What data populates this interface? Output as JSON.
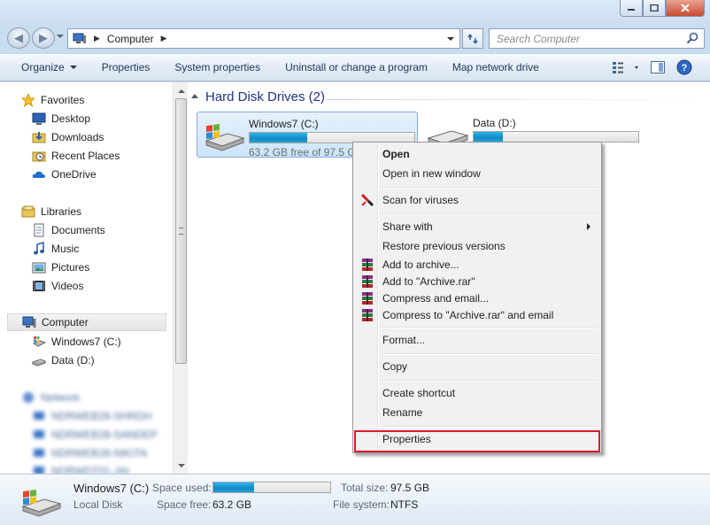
{
  "window": {
    "buttons": {
      "minimize": "minimize-icon",
      "maximize": "maximize-icon",
      "close": "close-icon"
    }
  },
  "address": {
    "location_icon": "computer-icon",
    "path": [
      "Computer"
    ],
    "search_placeholder": "Search Computer"
  },
  "toolbar": {
    "items": [
      {
        "label": "Organize",
        "dropdown": true
      },
      {
        "label": "Properties"
      },
      {
        "label": "System properties"
      },
      {
        "label": "Uninstall or change a program"
      },
      {
        "label": "Map network drive"
      }
    ],
    "right_icons": [
      "view-options-icon",
      "preview-pane-icon",
      "help-icon"
    ]
  },
  "nav": {
    "favorites": {
      "label": "Favorites",
      "items": [
        "Desktop",
        "Downloads",
        "Recent Places",
        "OneDrive"
      ]
    },
    "libraries": {
      "label": "Libraries",
      "items": [
        "Documents",
        "Music",
        "Pictures",
        "Videos"
      ]
    },
    "computer": {
      "label": "Computer",
      "items": [
        "Windows7 (C:)",
        "Data (D:)"
      ]
    },
    "network": {
      "label": "Network",
      "items": [
        "NDRWEB28-SHRDH",
        "NDRWEB28-SANDEP",
        "NDRWEB28-NIKITA",
        "NDRWDT01-JAI"
      ]
    }
  },
  "content": {
    "section_title": "Hard Disk Drives (2)",
    "drives": [
      {
        "name": "Windows7 (C:)",
        "free_text": "63.2 GB free of 97.5 GB",
        "used_fraction": 0.35,
        "selected": true
      },
      {
        "name": "Data (D:)",
        "free_text": "",
        "used_fraction": 0.18,
        "selected": false
      }
    ]
  },
  "context_menu": {
    "items": [
      {
        "label": "Open",
        "bold": true
      },
      {
        "label": "Open in new window"
      },
      {
        "label": "Scan for viruses",
        "icon": "antivirus-icon"
      },
      {
        "label": "Share with",
        "submenu": true
      },
      {
        "label": "Restore previous versions"
      },
      {
        "label": "Add to archive...",
        "icon": "winrar-icon"
      },
      {
        "label": "Add to \"Archive.rar\"",
        "icon": "winrar-icon"
      },
      {
        "label": "Compress and email...",
        "icon": "winrar-icon"
      },
      {
        "label": "Compress to \"Archive.rar\" and email",
        "icon": "winrar-icon"
      },
      {
        "label": "Format..."
      },
      {
        "label": "Copy"
      },
      {
        "label": "Create shortcut"
      },
      {
        "label": "Rename"
      },
      {
        "label": "Properties",
        "highlighted": true
      }
    ],
    "highlight_color": "#e01c2a"
  },
  "details": {
    "name": "Windows7 (C:)",
    "type": "Local Disk",
    "space_used_label": "Space used:",
    "space_used_fraction": 0.35,
    "space_free_label": "Space free:",
    "space_free": "63.2 GB",
    "total_size_label": "Total size:",
    "total_size": "97.5 GB",
    "file_system_label": "File system:",
    "file_system": "NTFS"
  },
  "colors": {
    "accent": "#1e3287",
    "progress": "#1b9bd6",
    "selection": "#cce4fb"
  }
}
